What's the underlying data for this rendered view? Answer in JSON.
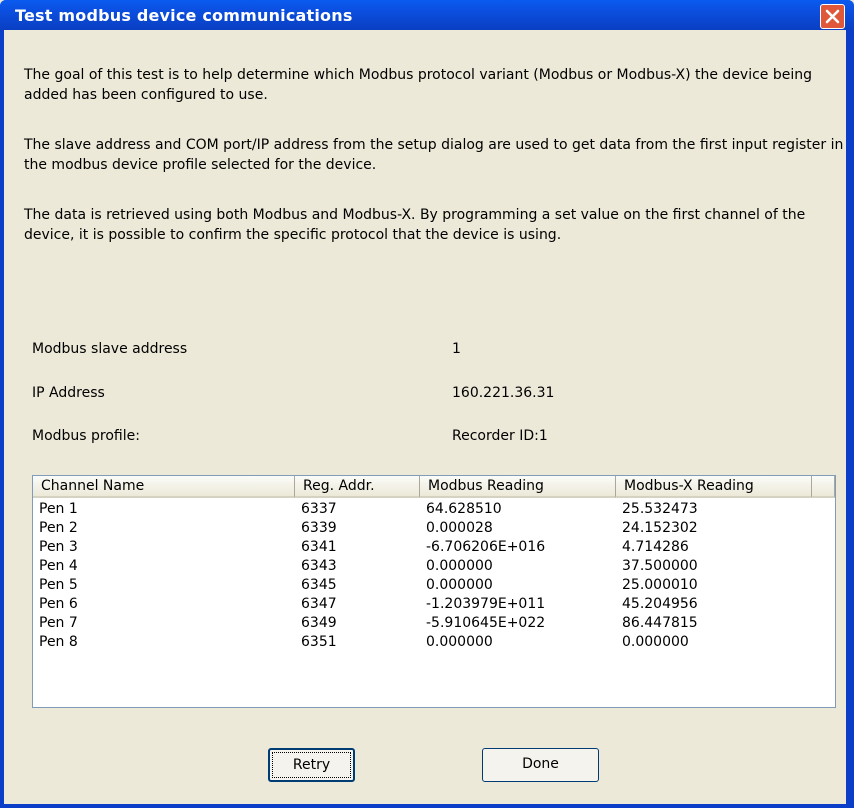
{
  "window": {
    "title": "Test modbus device communications",
    "close_icon": "close-icon"
  },
  "description": {
    "p1": "The goal of this test is to help determine which Modbus protocol variant (Modbus or Modbus-X) the device being added has been configured to use.",
    "p2": "The slave address and COM port/IP address from the setup dialog are used to get data from the first input register in the modbus device profile selected for the device.",
    "p3": "The data is retrieved using both Modbus and Modbus-X. By programming a set value on the first channel of the device, it is possible to confirm the specific protocol that the device is using."
  },
  "info": {
    "slave_label": "Modbus slave address",
    "slave_value": "1",
    "ip_label": "IP Address",
    "ip_value": "160.221.36.31",
    "profile_label": "Modbus profile:",
    "profile_value": "Recorder ID:1"
  },
  "table": {
    "headers": [
      "Channel Name",
      "Reg. Addr.",
      "Modbus Reading",
      "Modbus-X Reading"
    ],
    "rows": [
      [
        "Pen 1",
        "6337",
        "64.628510",
        "25.532473"
      ],
      [
        "Pen 2",
        "6339",
        "0.000028",
        "24.152302"
      ],
      [
        "Pen 3",
        "6341",
        "-6.706206E+016",
        "4.714286"
      ],
      [
        "Pen 4",
        "6343",
        "0.000000",
        "37.500000"
      ],
      [
        "Pen 5",
        "6345",
        "0.000000",
        "25.000010"
      ],
      [
        "Pen 6",
        "6347",
        "-1.203979E+011",
        "45.204956"
      ],
      [
        "Pen 7",
        "6349",
        "-5.910645E+022",
        "86.447815"
      ],
      [
        "Pen 8",
        "6351",
        "0.000000",
        "0.000000"
      ]
    ]
  },
  "buttons": {
    "retry": "Retry",
    "done": "Done"
  },
  "colors": {
    "titlebar": "#0a4fe0",
    "dialog_bg": "#ece9d8",
    "close": "#e0583a"
  }
}
